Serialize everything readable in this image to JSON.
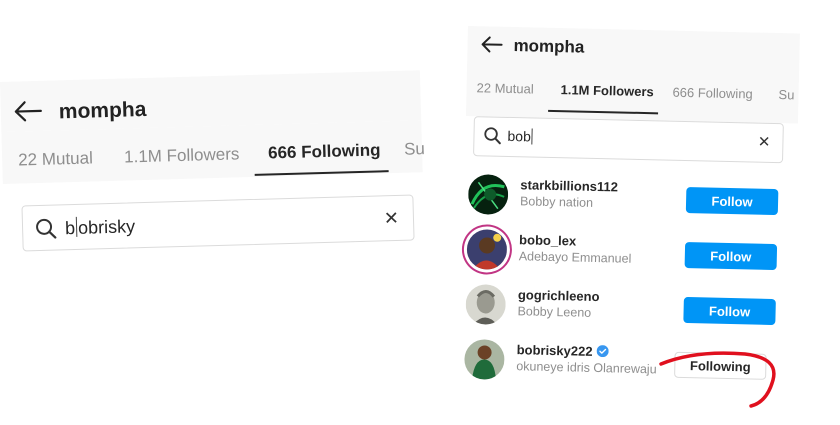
{
  "left_screen": {
    "title": "mompha",
    "tabs": [
      {
        "label": "22 Mutual",
        "active": false
      },
      {
        "label": "1.1M Followers",
        "active": false
      },
      {
        "label": "666 Following",
        "active": true
      },
      {
        "label": "Su",
        "active": false
      }
    ],
    "search": {
      "value_before_caret": "b",
      "value_after_caret": "obrisky"
    }
  },
  "right_screen": {
    "title": "mompha",
    "tabs": [
      {
        "label": "22 Mutual",
        "active": false
      },
      {
        "label": "1.1M Followers",
        "active": true
      },
      {
        "label": "666 Following",
        "active": false
      },
      {
        "label": "Su",
        "active": false
      }
    ],
    "search": {
      "value": "bob"
    },
    "results": [
      {
        "username": "starkbillions112",
        "full_name": "Bobby nation",
        "button": "Follow",
        "verified": false,
        "avatar": "green-digital-avatar"
      },
      {
        "username": "bobo_lex",
        "full_name": "Adebayo Emmanuel",
        "button": "Follow",
        "verified": false,
        "avatar": "person-avatar-story-ring"
      },
      {
        "username": "gogrichleeno",
        "full_name": "Bobby Leeno",
        "button": "Follow",
        "verified": false,
        "avatar": "banknote-portrait-avatar"
      },
      {
        "username": "bobrisky222",
        "full_name": "okuneye idris Olanrewaju",
        "button": "Following",
        "verified": true,
        "avatar": "woman-green-dress-avatar"
      }
    ]
  },
  "colors": {
    "follow_blue": "#0095f6",
    "verified_blue": "#3897f0",
    "annotation_red": "#e0101e",
    "tab_inactive": "#8e8e8e",
    "text_dark": "#262626"
  },
  "icons": [
    "back-arrow-icon",
    "search-icon",
    "clear-icon",
    "verified-badge-icon"
  ],
  "annotation": "red-hand-drawn-curve"
}
